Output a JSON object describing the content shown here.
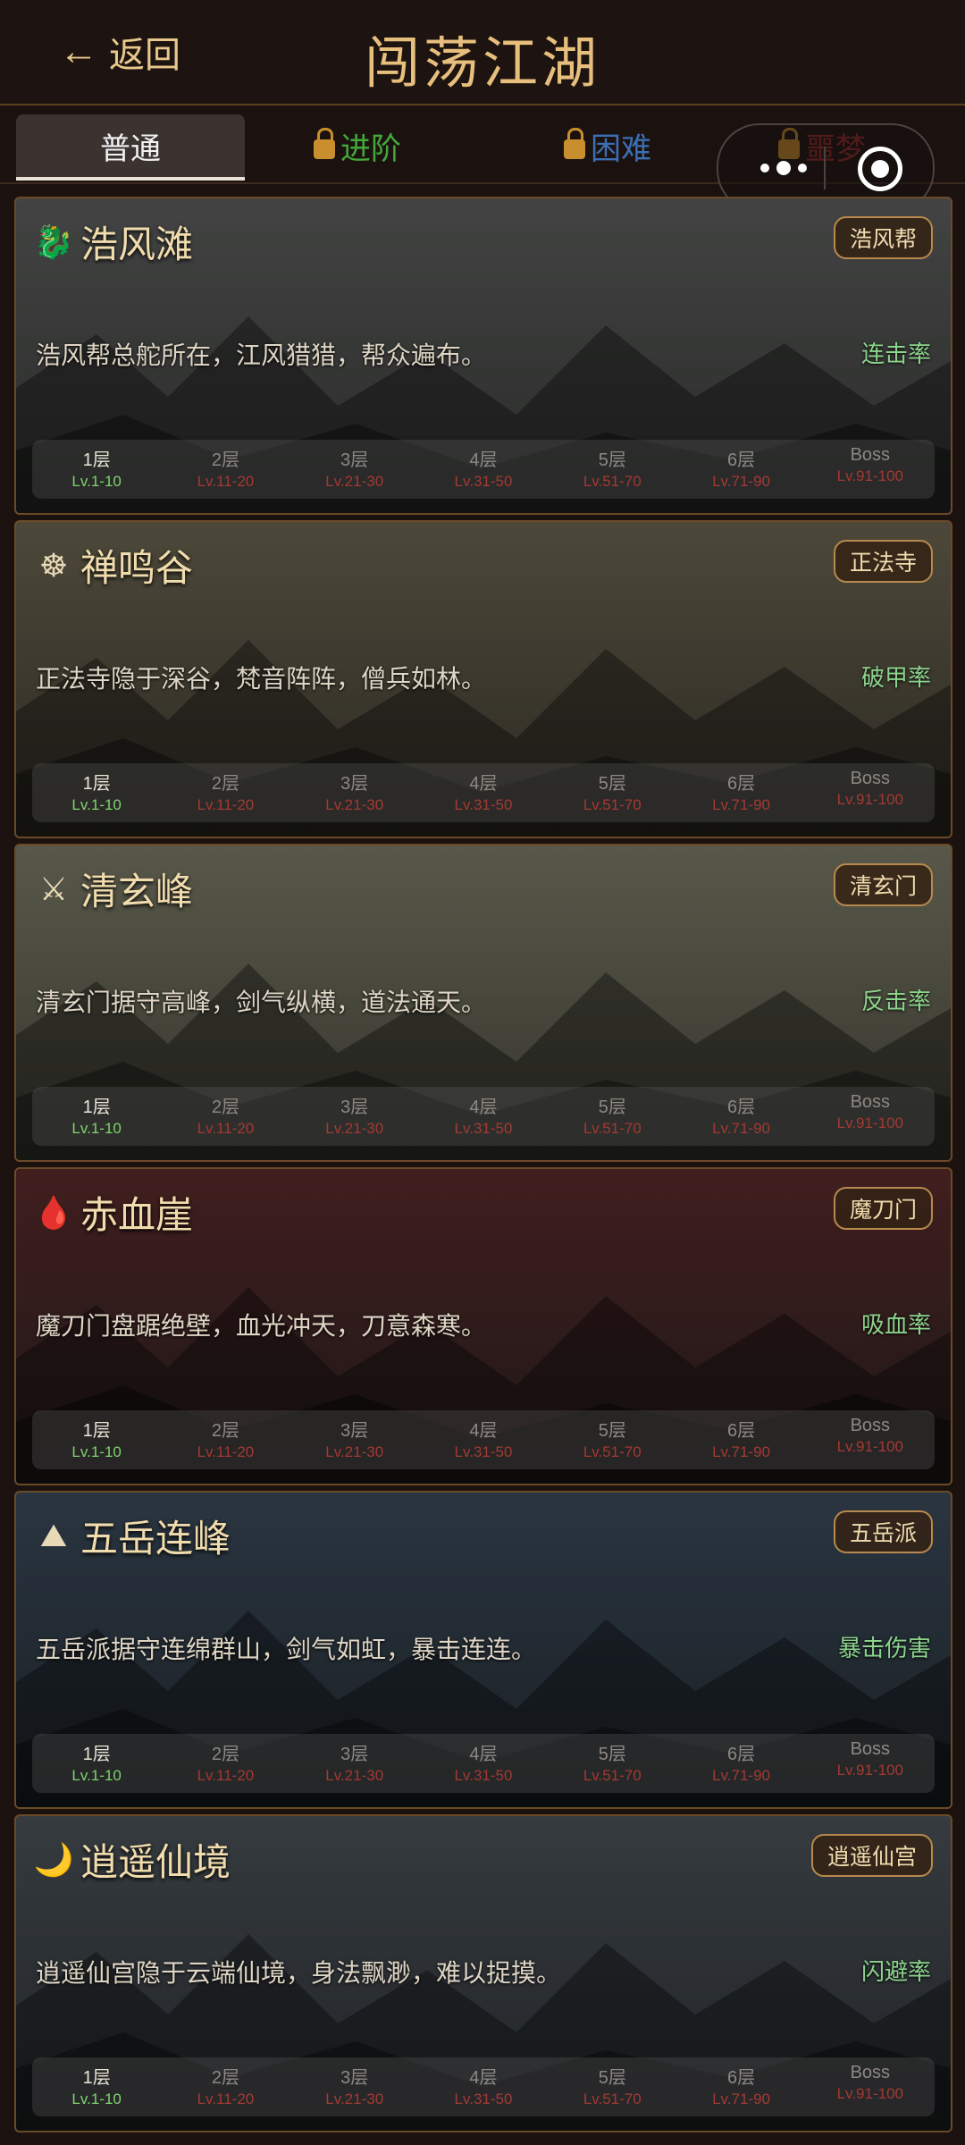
{
  "header": {
    "back_label": "返回",
    "title": "闯荡江湖"
  },
  "tabs": [
    {
      "label": "普通",
      "locked": false,
      "color": "#f2f2f2"
    },
    {
      "label": "进阶",
      "locked": true,
      "color": "#43a83a"
    },
    {
      "label": "困难",
      "locked": true,
      "color": "#3b6fb4"
    },
    {
      "label": "噩梦",
      "locked": true,
      "color": "#9b2c2c"
    }
  ],
  "regions": [
    {
      "icon": "🐉",
      "icon_name": "dragon-icon",
      "name": "浩风滩",
      "faction": "浩风帮",
      "desc": "浩风帮总舵所在，江风猎猎，帮众遍布。",
      "attr": "连击率",
      "bg": [
        "#5c5e5c",
        "#3a3c3a"
      ]
    },
    {
      "icon": "☸",
      "icon_name": "dharma-wheel-icon",
      "name": "禅鸣谷",
      "faction": "正法寺",
      "desc": "正法寺隐于深谷，梵音阵阵，僧兵如林。",
      "attr": "破甲率",
      "bg": [
        "#6a6450",
        "#3e3a30"
      ]
    },
    {
      "icon": "⚔",
      "icon_name": "crossed-swords-icon",
      "name": "清玄峰",
      "faction": "清玄门",
      "desc": "清玄门据守高峰，剑气纵横，道法通天。",
      "attr": "反击率",
      "bg": [
        "#7a7a66",
        "#4a4a40"
      ]
    },
    {
      "icon": "🩸",
      "icon_name": "blood-drop-icon",
      "name": "赤血崖",
      "faction": "魔刀门",
      "desc": "魔刀门盘踞绝壁，血光冲天，刀意森寒。",
      "attr": "吸血率",
      "bg": [
        "#5a2a2a",
        "#2a2222"
      ]
    },
    {
      "icon": "⛰",
      "icon_name": "mountain-icon",
      "name": "五岳连峰",
      "faction": "五岳派",
      "desc": "五岳派据守连绵群山，剑气如虹，暴击连连。",
      "attr": "暴击伤害",
      "bg": [
        "#3a4a5a",
        "#262c32"
      ]
    },
    {
      "icon": "🌙",
      "icon_name": "crescent-moon-icon",
      "name": "逍遥仙境",
      "faction": "逍遥仙宫",
      "desc": "逍遥仙宫隐于云端仙境，身法飘渺，难以捉摸。",
      "attr": "闪避率",
      "bg": [
        "#4a5258",
        "#2e3236"
      ]
    }
  ],
  "levels": [
    {
      "name": "1层",
      "range": "Lv.1-10",
      "unlocked": true
    },
    {
      "name": "2层",
      "range": "Lv.11-20",
      "unlocked": false
    },
    {
      "name": "3层",
      "range": "Lv.21-30",
      "unlocked": false
    },
    {
      "name": "4层",
      "range": "Lv.31-50",
      "unlocked": false
    },
    {
      "name": "5层",
      "range": "Lv.51-70",
      "unlocked": false
    },
    {
      "name": "6层",
      "range": "Lv.71-90",
      "unlocked": false
    },
    {
      "name": "Boss",
      "range": "Lv.91-100",
      "unlocked": false
    }
  ]
}
